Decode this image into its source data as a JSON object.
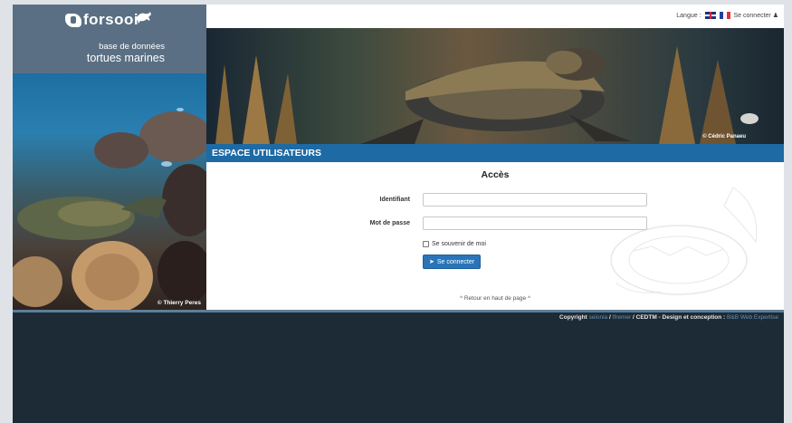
{
  "brand": {
    "logo_text": "forsooi",
    "tagline_line1": "base de données",
    "tagline_line2": "tortues marines"
  },
  "sidebar": {
    "photo_credit": "© Thierry Peres"
  },
  "header": {
    "language_label": "Langue :",
    "login_link": "Se connecter"
  },
  "banner": {
    "photo_credit": "© Cédric Panaeu"
  },
  "section": {
    "title": "ESPACE UTILISATEURS"
  },
  "form": {
    "title": "Accès",
    "username_label": "Identifiant",
    "username_value": "",
    "password_label": "Mot de passe",
    "password_value": "",
    "remember_label": "Se souvenir de moi",
    "submit_label": "Se connecter"
  },
  "back_to_top": "^ Retour en haut de page ^",
  "footer": {
    "copyright_label": "Copyright",
    "link1": "seionia",
    "sep1": "/",
    "link2": "Ifremer",
    "rest": "/ CEDTM - Design et conception :",
    "link3": "B&B Web Expertise"
  },
  "colors": {
    "primary_blue": "#1d6aa5",
    "dark_background": "#1d2b37",
    "logo_panel": "#5a6f83",
    "button_blue": "#2a74b8"
  },
  "icons": {
    "uk_flag": "uk-flag-icon",
    "fr_flag": "fr-flag-icon",
    "user": "user-icon",
    "login": "sign-in-icon"
  }
}
